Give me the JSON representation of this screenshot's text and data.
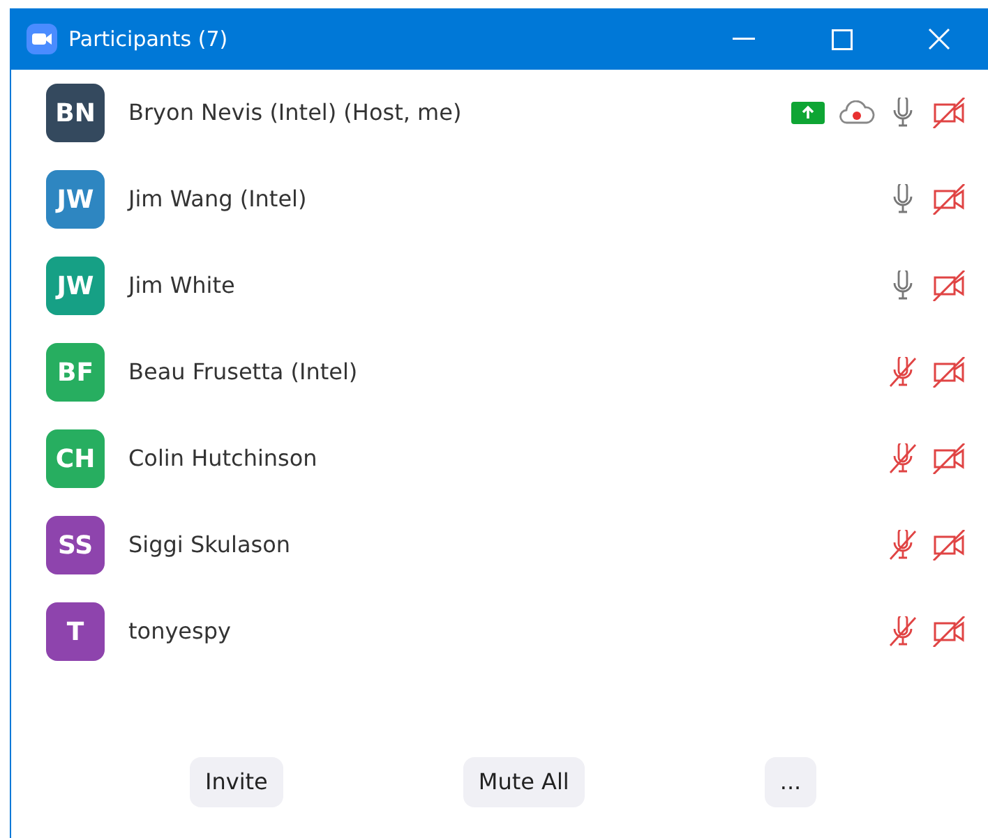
{
  "window": {
    "title": "Participants (7)"
  },
  "participants": [
    {
      "initials": "BN",
      "name": "Bryon Nevis (Intel) (Host, me)",
      "color": "#34495e",
      "sharing": true,
      "recording": true,
      "muted": false,
      "video_off": true
    },
    {
      "initials": "JW",
      "name": "Jim Wang (Intel)",
      "color": "#2e86c1",
      "sharing": false,
      "recording": false,
      "muted": false,
      "video_off": true
    },
    {
      "initials": "JW",
      "name": "Jim White",
      "color": "#16a085",
      "sharing": false,
      "recording": false,
      "muted": false,
      "video_off": true
    },
    {
      "initials": "BF",
      "name": "Beau Frusetta (Intel)",
      "color": "#27ae60",
      "sharing": false,
      "recording": false,
      "muted": true,
      "video_off": true
    },
    {
      "initials": "CH",
      "name": "Colin Hutchinson",
      "color": "#27ae60",
      "sharing": false,
      "recording": false,
      "muted": true,
      "video_off": true
    },
    {
      "initials": "SS",
      "name": "Siggi Skulason",
      "color": "#8e44ad",
      "sharing": false,
      "recording": false,
      "muted": true,
      "video_off": true
    },
    {
      "initials": "T",
      "name": "tonyespy",
      "color": "#8e44ad",
      "sharing": false,
      "recording": false,
      "muted": true,
      "video_off": true
    }
  ],
  "buttons": [
    {
      "label": "Invite"
    },
    {
      "label": "Mute All"
    },
    {
      "label": "..."
    }
  ]
}
